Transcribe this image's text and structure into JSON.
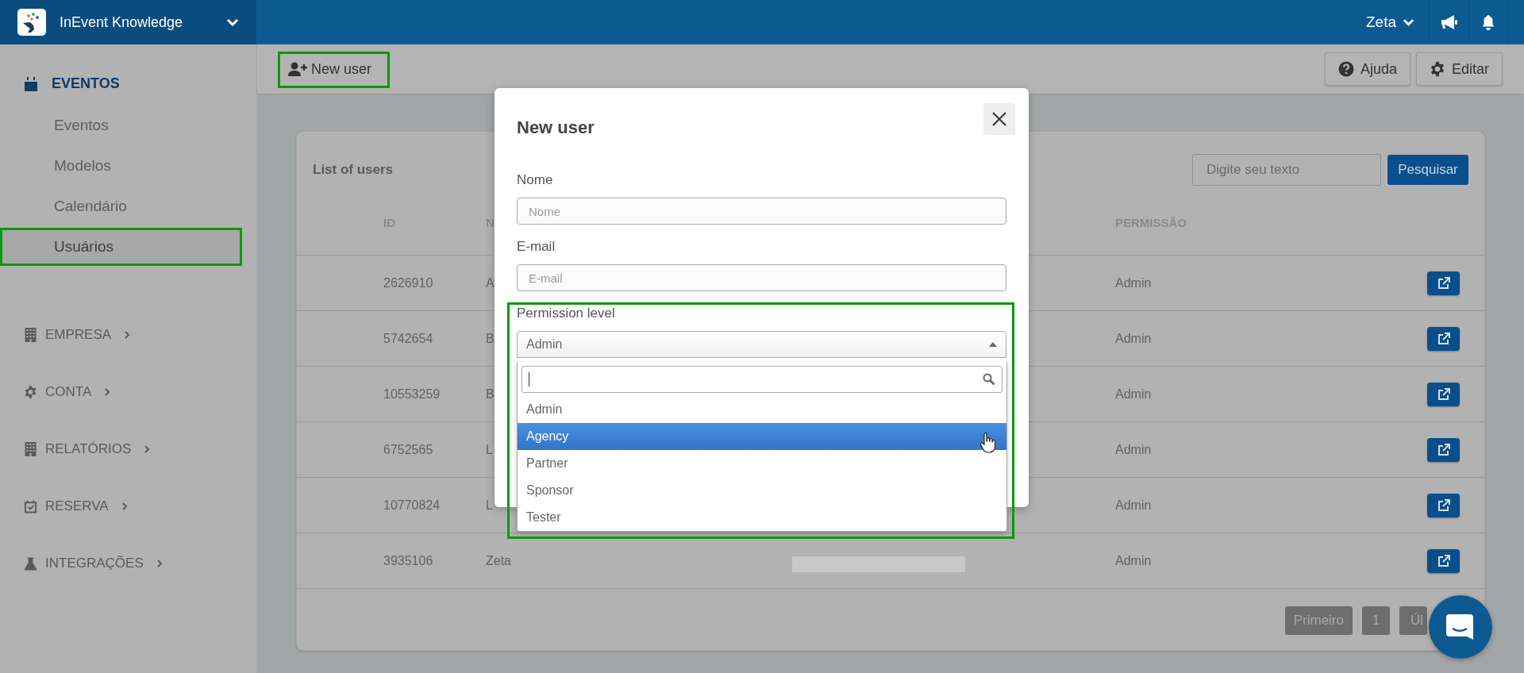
{
  "header": {
    "workspace": "InEvent Knowledge",
    "user": "Zeta"
  },
  "sidebar": {
    "section": "EVENTOS",
    "items": [
      {
        "label": "Eventos",
        "selected": false,
        "highlighted": false
      },
      {
        "label": "Modelos",
        "selected": false,
        "highlighted": false
      },
      {
        "label": "Calendário",
        "selected": false,
        "highlighted": false
      },
      {
        "label": "Usuários",
        "selected": true,
        "highlighted": true
      }
    ],
    "groups": [
      {
        "label": "EMPRESA"
      },
      {
        "label": "CONTA"
      },
      {
        "label": "RELATÓRIOS"
      },
      {
        "label": "RESERVA"
      },
      {
        "label": "INTEGRAÇÕES"
      }
    ]
  },
  "toolbar": {
    "new_user": {
      "label": "New user",
      "highlighted": true
    },
    "buttons": [
      {
        "label": "Ajuda"
      },
      {
        "label": "Editar"
      }
    ]
  },
  "users_card": {
    "title": "List of users",
    "search": {
      "placeholder": "Digite seu texto"
    },
    "search_button": "Pesquisar",
    "columns": [
      "ID",
      "N",
      "PERMISSÃO"
    ],
    "rows": [
      {
        "id": "2626910",
        "name": "A",
        "permission": "Admin"
      },
      {
        "id": "5742654",
        "name": "B",
        "permission": "Admin"
      },
      {
        "id": "10553259",
        "name": "B",
        "permission": "Admin"
      },
      {
        "id": "6752565",
        "name": "L",
        "permission": "Admin"
      },
      {
        "id": "10770824",
        "name": "L",
        "permission": "Admin"
      },
      {
        "id": "3935106",
        "name": "Zeta",
        "email_redacted": true,
        "permission": "Admin"
      }
    ],
    "pagination": [
      "Primeiro",
      "1",
      "Úl"
    ]
  },
  "modal": {
    "title": "New user",
    "fields": [
      {
        "label": "Nome",
        "placeholder": "Nome"
      },
      {
        "label": "E-mail",
        "placeholder": "E-mail"
      }
    ],
    "permission": {
      "label": "Permission level",
      "value": "Admin",
      "expanded": true,
      "highlighted": true,
      "options": [
        {
          "label": "Admin",
          "highlighted": false
        },
        {
          "label": "Agency",
          "highlighted": true
        },
        {
          "label": "Partner",
          "highlighted": false
        },
        {
          "label": "Sponsor",
          "highlighted": false
        },
        {
          "label": "Tester",
          "highlighted": false
        }
      ]
    }
  }
}
